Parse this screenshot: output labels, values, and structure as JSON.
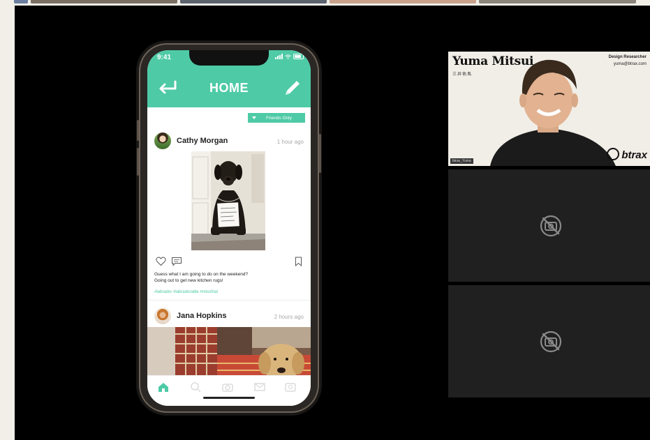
{
  "phone": {
    "status_time": "9:41",
    "header_title": "HOME",
    "filter_label": "Friends Only",
    "posts": [
      {
        "author": "Cathy Morgan",
        "time": "1 hour ago",
        "caption_line1": "Guess what I am going to do on the weekend?",
        "caption_line2": "Going out to get new kitchen rugs!",
        "tags": "#labrador #labradorable #missthat"
      },
      {
        "author": "Jana Hopkins",
        "time": "2 hours ago"
      }
    ],
    "tabs": [
      "home-icon",
      "search-icon",
      "camera-icon",
      "message-icon",
      "profile-icon"
    ],
    "accent": "#4ecaa6"
  },
  "video_tiles": {
    "speaker": {
      "name": "Yuma Mitsui",
      "name_jp": "三井佑馬",
      "role": "Design Researcher",
      "email": "yuma@btrax.com",
      "brand": "btrax",
      "user_label": "btrax_Yuma"
    },
    "muted_tiles": [
      {
        "icon": "camera-off-icon"
      },
      {
        "icon": "camera-off-icon"
      }
    ]
  }
}
